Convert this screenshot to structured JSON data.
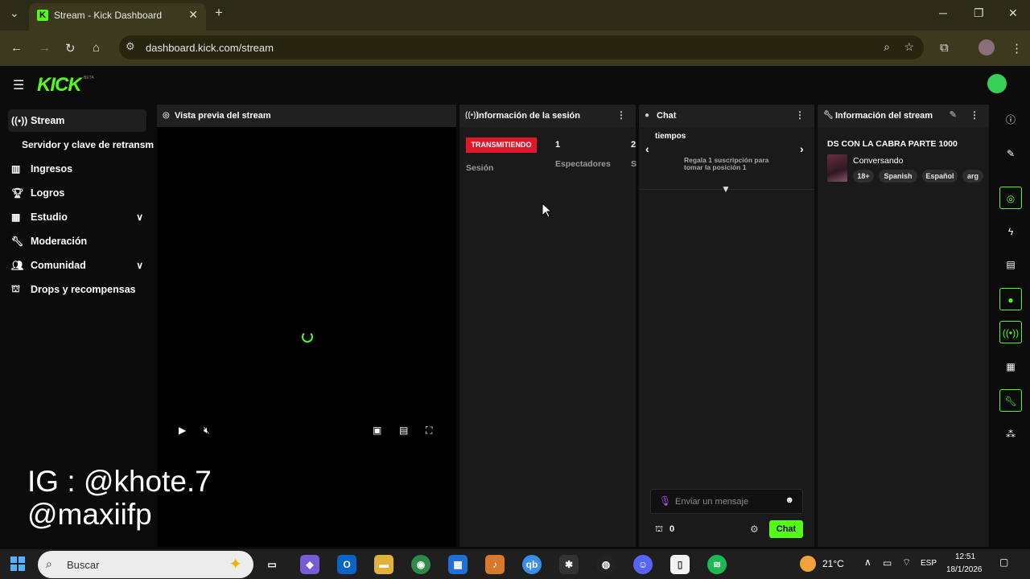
{
  "browser": {
    "tab_title": "Stream - Kick Dashboard",
    "url": "dashboard.kick.com/stream"
  },
  "app": {
    "logo": "KICK",
    "beta": "BETA"
  },
  "sidebar": {
    "items": [
      {
        "label": "Stream",
        "icon": "broadcast-icon"
      },
      {
        "label": "Servidor y clave de retransm",
        "icon": ""
      },
      {
        "label": "Ingresos",
        "icon": "chart-icon"
      },
      {
        "label": "Logros",
        "icon": "trophy-icon"
      },
      {
        "label": "Estudio",
        "icon": "grid-icon"
      },
      {
        "label": "Moderación",
        "icon": "wrench-icon"
      },
      {
        "label": "Comunidad",
        "icon": "people-icon"
      },
      {
        "label": "Drops y recompensas",
        "icon": "gift-icon"
      }
    ]
  },
  "preview": {
    "title": "Vista previa del stream"
  },
  "session": {
    "title": "Información de la sesión",
    "live_badge": "TRANSMITIENDO",
    "session_label": "Sesión",
    "viewers_count": "1",
    "viewers_label": "Espectadores",
    "next_count": "2",
    "next_label": "S"
  },
  "chat": {
    "title": "Chat",
    "goal_text": "tiempos",
    "gift_text": "Regala 1 suscripción para tomar la posición 1",
    "input_placeholder": "Enviar un mensaje",
    "points": "0",
    "send_label": "Chat"
  },
  "stream_info": {
    "title": "Información del stream",
    "stream_title": "DS CON LA CABRA PARTE 1000",
    "category": "Conversando",
    "tags": [
      "18+",
      "Spanish",
      "Español",
      "arg"
    ]
  },
  "overlay": {
    "line1": "IG : @khote.7",
    "line2": "@maxiifp"
  },
  "taskbar": {
    "search_placeholder": "Buscar",
    "weather": "21°C",
    "lang": "ESP",
    "time": "12:51",
    "date": "18/1/2026"
  },
  "colors": {
    "kick_green": "#53fc18",
    "live_red": "#e0162b"
  }
}
